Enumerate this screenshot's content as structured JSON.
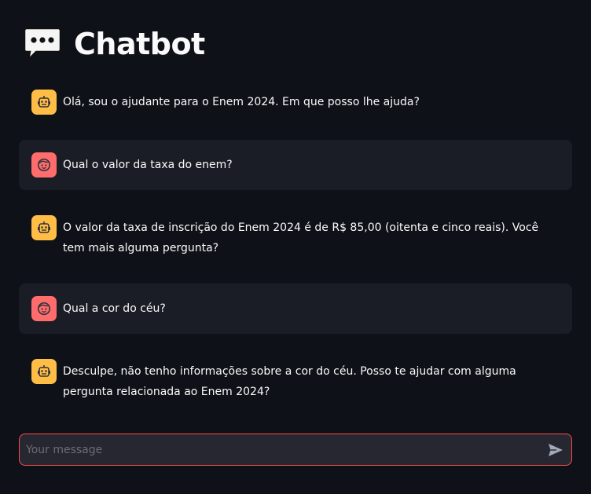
{
  "header": {
    "title": "Chatbot",
    "icon": "speech-balloon-icon"
  },
  "messages": [
    {
      "role": "assistant",
      "avatar_icon": "robot-face-icon",
      "text": "Olá, sou o ajudante para o Enem 2024. Em que posso lhe ajuda?"
    },
    {
      "role": "user",
      "avatar_icon": "user-face-icon",
      "text": "Qual o valor da taxa do enem?"
    },
    {
      "role": "assistant",
      "avatar_icon": "robot-face-icon",
      "text": "O valor da taxa de inscrição do Enem 2024 é de R$ 85,00 (oitenta e cinco reais). Você tem mais alguma pergunta?"
    },
    {
      "role": "user",
      "avatar_icon": "user-face-icon",
      "text": "Qual a cor do céu?"
    },
    {
      "role": "assistant",
      "avatar_icon": "robot-face-icon",
      "text": "Desculpe, não tenho informações sobre a cor do céu. Posso te ajudar com alguma pergunta relacionada ao Enem 2024?"
    }
  ],
  "chat_input": {
    "placeholder": "Your message",
    "value": "",
    "send_icon": "send-arrow-icon"
  },
  "colors": {
    "background": "#0e1117",
    "user_message_bg": "#1b1d26",
    "assistant_avatar": "#ffbd45",
    "user_avatar": "#ff6c6c",
    "input_border": "#ff4b4b",
    "input_bg": "#262730"
  }
}
